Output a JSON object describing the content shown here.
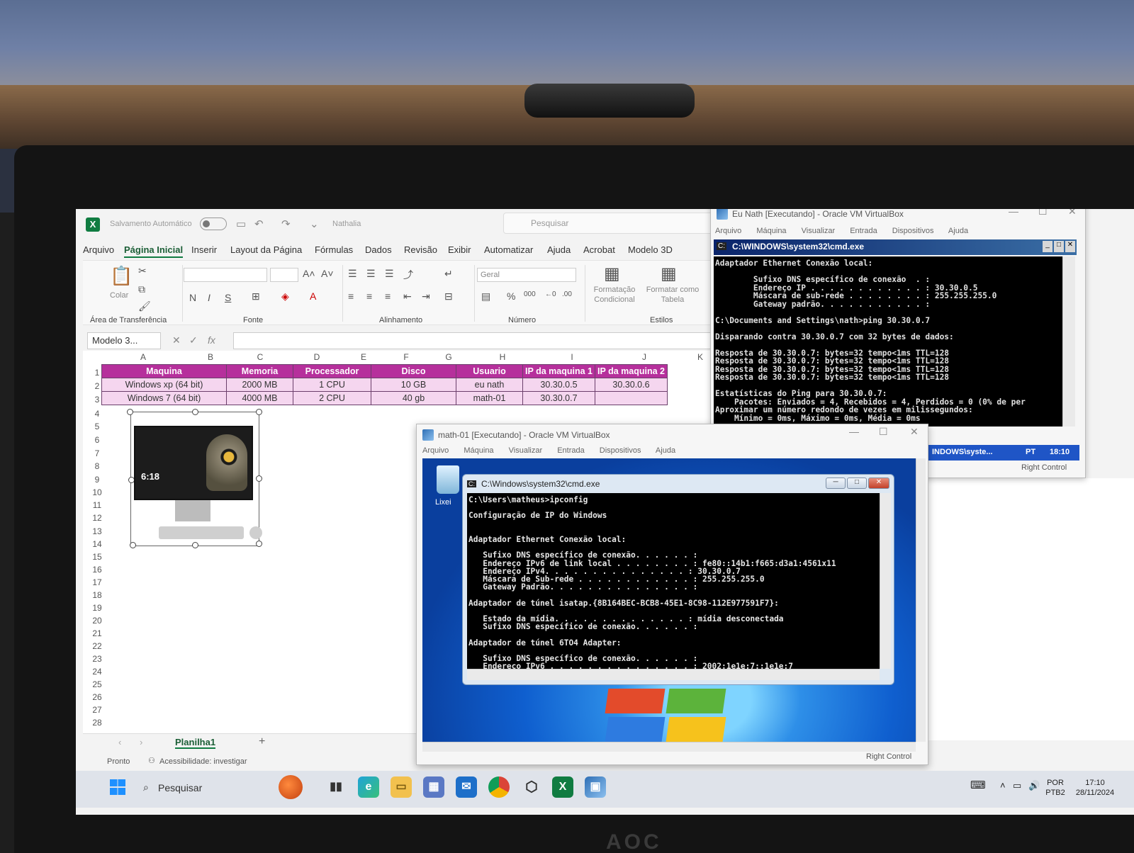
{
  "excel": {
    "autosave_label": "Salvamento Automático",
    "doc_name": "Nathalia",
    "search_placeholder": "Pesquisar",
    "menu": [
      "Arquivo",
      "Página Inicial",
      "Inserir",
      "Layout da Página",
      "Fórmulas",
      "Dados",
      "Revisão",
      "Exibir",
      "Automatizar",
      "Ajuda",
      "Acrobat",
      "Modelo 3D"
    ],
    "ribbon": {
      "paste": "Colar",
      "clipboard": "Área de Transferência",
      "font": "Fonte",
      "alignment": "Alinhamento",
      "number_format": "Geral",
      "number": "Número",
      "cond_format": "Formatação\nCondicional",
      "format_table": "Formatar como\nTabela",
      "styles": "Estilos",
      "bold": "N",
      "italic": "I",
      "underline": "S"
    },
    "name_box": "Modelo 3...",
    "columns": [
      "A",
      "B",
      "C",
      "D",
      "E",
      "F",
      "G",
      "H",
      "I",
      "J",
      "K"
    ],
    "rows": [
      "1",
      "2",
      "3",
      "4",
      "5",
      "6",
      "7",
      "8",
      "9",
      "10",
      "11",
      "12",
      "13",
      "14",
      "15",
      "16",
      "17",
      "18",
      "19",
      "20",
      "21",
      "22",
      "23",
      "24",
      "25",
      "26",
      "27",
      "28"
    ],
    "table": {
      "headers": [
        "Maquina",
        "Memoria",
        "Processador",
        "Disco",
        "Usuario",
        "IP da maquina 1",
        "IP da maquina 2"
      ],
      "rows": [
        [
          "Windows xp (64 bit)",
          "2000 MB",
          "1 CPU",
          "10 GB",
          "eu nath",
          "30.30.0.5",
          "30.30.0.6"
        ],
        [
          "Windows 7 (64 bit)",
          "4000 MB",
          "2 CPU",
          "40 gb",
          "math-01",
          "30.30.0.7",
          ""
        ]
      ]
    },
    "image_clock": "6:18",
    "sheet_tab": "Planilha1",
    "status_ready": "Pronto",
    "status_accessibility": "Acessibilidade: investigar"
  },
  "vb1": {
    "title": "Eu Nath [Executando] - Oracle VM VirtualBox",
    "menu": [
      "Arquivo",
      "Máquina",
      "Visualizar",
      "Entrada",
      "Dispositivos",
      "Ajuda"
    ],
    "cmd_title": "C:\\WINDOWS\\system32\\cmd.exe",
    "cmd_text": "Adaptador Ethernet Conexão local:\n\n        Sufixo DNS específico de conexão  . :\n        Endereço IP . . . . . . . . . . . . : 30.30.0.5\n        Máscara de sub-rede . . . . . . . . : 255.255.255.0\n        Gateway padrão. . . . . . . . . . . :\n\nC:\\Documents and Settings\\nath>ping 30.30.0.7\n\nDisparando contra 30.30.0.7 com 32 bytes de dados:\n\nResposta de 30.30.0.7: bytes=32 tempo<1ms TTL=128\nResposta de 30.30.0.7: bytes=32 tempo<1ms TTL=128\nResposta de 30.30.0.7: bytes=32 tempo<1ms TTL=128\nResposta de 30.30.0.7: bytes=32 tempo<1ms TTL=128\n\nEstatísticas do Ping para 30.30.0.7:\n    Pacotes: Enviados = 4, Recebidos = 4, Perdidos = 0 (0% de per\nAproximar um número redondo de vezes em milissegundos:\n    Mínimo = 0ms, Máximo = 0ms, Média = 0ms",
    "taskbar_item": "INDOWS\\syste...",
    "taskbar_lang": "PT",
    "taskbar_time": "18:10",
    "host_key": "Right Control"
  },
  "vb2": {
    "title": "math-01 [Executando] - Oracle VM VirtualBox",
    "menu": [
      "Arquivo",
      "Máquina",
      "Visualizar",
      "Entrada",
      "Dispositivos",
      "Ajuda"
    ],
    "recycle_label": "Lixei",
    "cmd_title": "C:\\Windows\\system32\\cmd.exe",
    "cmd_text": "C:\\Users\\matheus>ipconfig\n\nConfiguração de IP do Windows\n\n\nAdaptador Ethernet Conexão local:\n\n   Sufixo DNS específico de conexão. . . . . . :\n   Endereço IPv6 de link local . . . . . . . . : fe80::14b1:f665:d3a1:4561x11\n   Endereço IPv4. . . . . . . . . . . . . . . : 30.30.0.7\n   Máscara de Sub-rede . . . . . . . . . . . . : 255.255.255.0\n   Gateway Padrão. . . . . . . . . . . . . . . :\n\nAdaptador de túnel isatap.{8B164BEC-BCB8-45E1-8C98-112E977591F7}:\n\n   Estado da mídia. . . . . . . . . . . . . . : mídia desconectada\n   Sufixo DNS específico de conexão. . . . . . :\n\nAdaptador de túnel 6TO4 Adapter:\n\n   Sufixo DNS específico de conexão. . . . . . :\n   Endereço IPv6 . . . . . . . . . . . . . . . : 2002:1e1e:7::1e1e:7",
    "host_key": "Right Control"
  },
  "taskbar": {
    "search": "Pesquisar",
    "lang_top": "POR",
    "lang_bottom": "PTB2",
    "time": "17:10",
    "date": "28/11/2024"
  },
  "bezel_brand": "AOC"
}
